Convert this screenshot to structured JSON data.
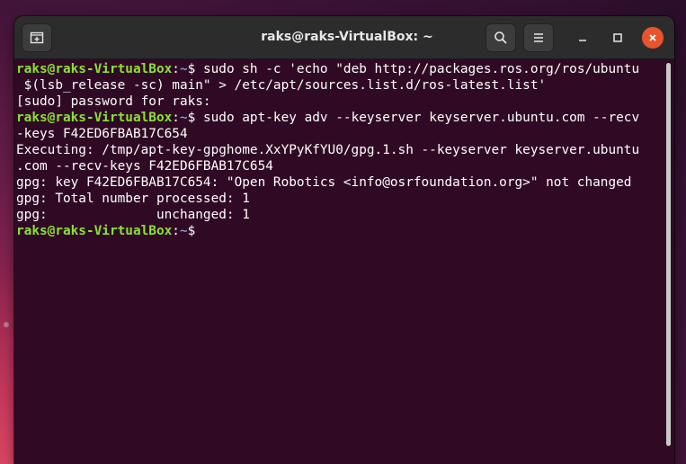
{
  "window": {
    "title": "raks@raks-VirtualBox: ~"
  },
  "icons": {
    "new_tab": "new-tab-icon",
    "search": "search-icon",
    "menu": "hamburger-menu-icon",
    "minimize": "minimize-icon",
    "maximize": "maximize-icon",
    "close": "close-icon"
  },
  "colors": {
    "terminal_bg": "#300a24",
    "prompt_user": "#8ae234",
    "prompt_path": "#729fcf",
    "close_button": "#e9542d"
  },
  "terminal": {
    "prompt_user": "raks@raks-VirtualBox",
    "prompt_sep": ":",
    "prompt_path": "~",
    "prompt_symbol": "$ ",
    "lines": [
      {
        "type": "cmd",
        "text": "sudo sh -c 'echo \"deb http://packages.ros.org/ros/ubuntu"
      },
      {
        "type": "out",
        "text": " $(lsb_release -sc) main\" > /etc/apt/sources.list.d/ros-latest.list'"
      },
      {
        "type": "out",
        "text": "[sudo] password for raks:"
      },
      {
        "type": "cmd",
        "text": "sudo apt-key adv --keyserver keyserver.ubuntu.com --recv"
      },
      {
        "type": "out",
        "text": "-keys F42ED6FBAB17C654"
      },
      {
        "type": "out",
        "text": "Executing: /tmp/apt-key-gpghome.XxYPyKfYU0/gpg.1.sh --keyserver keyserver.ubuntu"
      },
      {
        "type": "out",
        "text": ".com --recv-keys F42ED6FBAB17C654"
      },
      {
        "type": "out",
        "text": "gpg: key F42ED6FBAB17C654: \"Open Robotics <info@osrfoundation.org>\" not changed"
      },
      {
        "type": "out",
        "text": "gpg: Total number processed: 1"
      },
      {
        "type": "out",
        "text": "gpg:              unchanged: 1"
      },
      {
        "type": "cmd",
        "text": ""
      }
    ]
  }
}
